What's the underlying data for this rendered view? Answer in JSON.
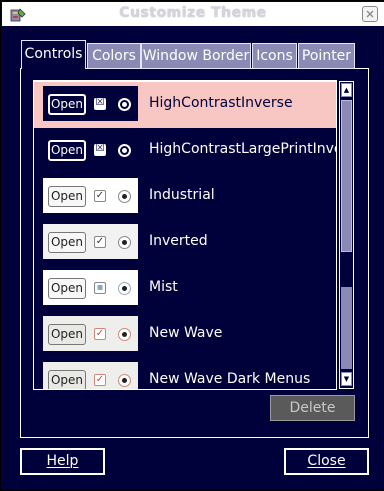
{
  "window": {
    "title": "Customize Theme",
    "app_icon": "theme-settings-icon",
    "close_icon": "window-close-icon"
  },
  "tabs": [
    {
      "label": "Controls",
      "active": true
    },
    {
      "label": "Colors",
      "active": false
    },
    {
      "label": "Window Border",
      "active": false
    },
    {
      "label": "Icons",
      "active": false
    },
    {
      "label": "Pointer",
      "active": false
    }
  ],
  "themes": [
    {
      "name": "HighContrastInverse",
      "preview_button": "Open",
      "check": "☒",
      "selected": true
    },
    {
      "name": "HighContrastLargePrintInver",
      "preview_button": "Open",
      "check": "☒",
      "selected": false
    },
    {
      "name": "Industrial",
      "preview_button": "Open",
      "check": "✓",
      "selected": false
    },
    {
      "name": "Inverted",
      "preview_button": "Open",
      "check": "✓",
      "selected": false
    },
    {
      "name": "Mist",
      "preview_button": "Open",
      "check": "▪",
      "selected": false
    },
    {
      "name": "New Wave",
      "preview_button": "Open",
      "check": "✓",
      "selected": false
    },
    {
      "name": "New Wave Dark Menus",
      "preview_button": "Open",
      "check": "✓",
      "selected": false
    }
  ],
  "actions": {
    "delete": "Delete",
    "help": "Help",
    "close": "Close"
  },
  "colors": {
    "background": "#00003a",
    "selected_row": "#f8c7c3",
    "inactive_tab": "#8a8ab4",
    "disabled_button": "#5a5a5a"
  }
}
